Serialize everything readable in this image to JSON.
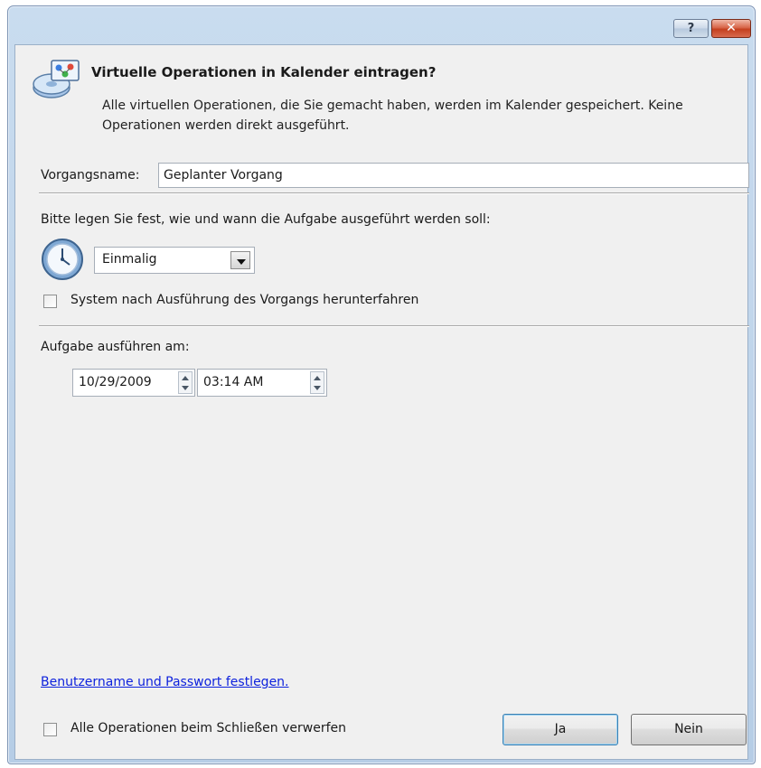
{
  "window": {
    "help_glyph": "?",
    "close_glyph": "✕"
  },
  "header": {
    "title": "Virtuelle Operationen in Kalender eintragen?",
    "description": "Alle virtuellen Operationen, die Sie gemacht haben, werden im Kalender gespeichert. Keine Operationen werden direkt ausgeführt.",
    "icon": "disk-operations-icon"
  },
  "form": {
    "task_name_label": "Vorgangsname:",
    "task_name_value": "Geplanter Vorgang",
    "schedule_prompt": "Bitte legen Sie fest, wie und wann die Aufgabe ausgeführt werden soll:",
    "frequency_value": "Einmalig",
    "shutdown_label": "System nach Ausführung des Vorgangs herunterfahren",
    "shutdown_checked": false,
    "run_at_label": "Aufgabe ausführen am:",
    "date_value": "10/29/2009",
    "time_value": "03:14 AM"
  },
  "footer": {
    "credentials_link": "Benutzername und Passwort festlegen.",
    "discard_label": "Alle Operationen beim Schließen verwerfen",
    "discard_checked": false,
    "yes_button": "Ja",
    "no_button": "Nein"
  },
  "colors": {
    "link": "#0e22dd",
    "dialog_background": "#f0f0f0",
    "frame": "#b6cde6"
  }
}
